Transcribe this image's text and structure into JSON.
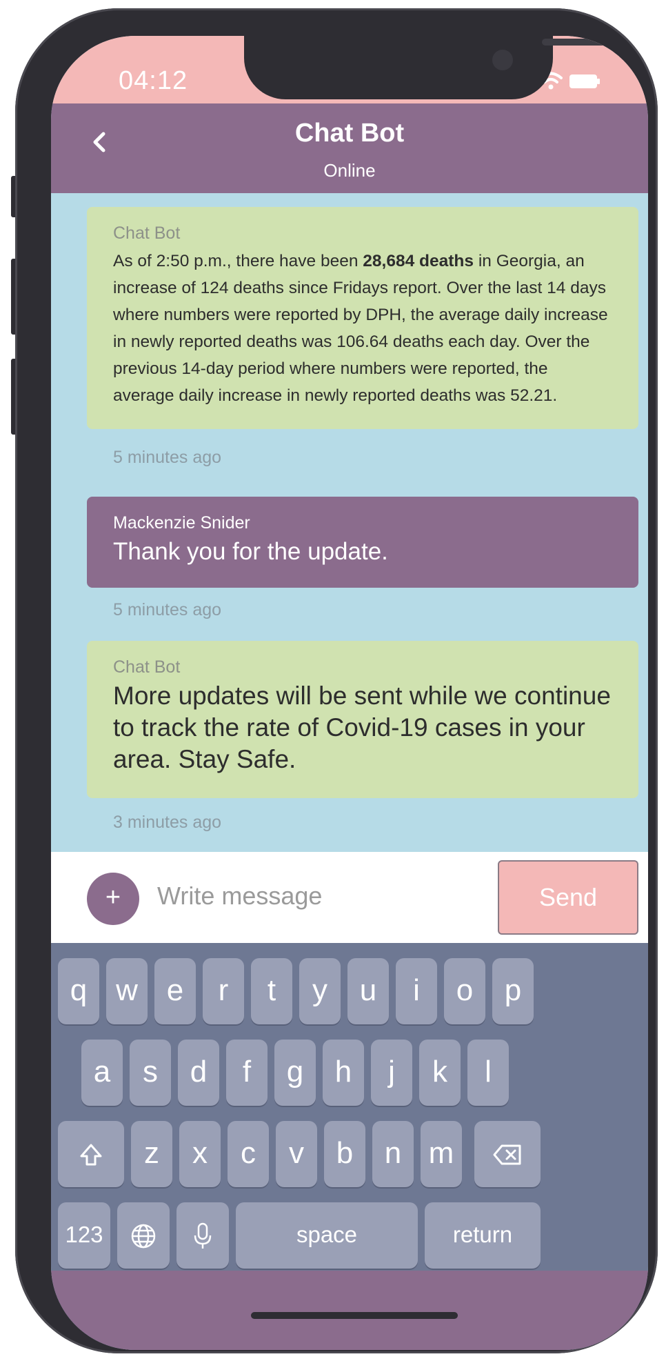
{
  "status_bar": {
    "time": "04:12"
  },
  "header": {
    "title": "Chat Bot",
    "status": "Online",
    "back_icon": "chevron-left-icon"
  },
  "messages": [
    {
      "sender": "Chat Bot",
      "text_before": "As of 2:50 p.m., there have been ",
      "text_bold": "28,684 deaths",
      "text_after": " in Georgia, an increase of 124 deaths since Fridays report. Over the last 14 days where numbers were reported by DPH, the average daily increase in newly reported deaths was 106.64 deaths each day. Over the previous 14-day period where numbers were reported, the average daily increase in newly reported deaths was 52.21.",
      "time": "5 minutes ago"
    },
    {
      "sender": "Mackenzie Snider",
      "text": "Thank you for the update.",
      "time": "5 minutes ago"
    },
    {
      "sender": "Chat Bot",
      "text": "More updates will be sent while we continue to track the rate of Covid-19 cases in your area. Stay Safe.",
      "time": "3 minutes ago"
    }
  ],
  "composer": {
    "plus_label": "+",
    "placeholder": "Write message",
    "send_label": "Send"
  },
  "keyboard": {
    "row1": [
      "q",
      "w",
      "e",
      "r",
      "t",
      "y",
      "u",
      "i",
      "o",
      "p"
    ],
    "row2": [
      "a",
      "s",
      "d",
      "f",
      "g",
      "h",
      "j",
      "k",
      "l"
    ],
    "row3": [
      "z",
      "x",
      "c",
      "v",
      "b",
      "n",
      "m"
    ],
    "numbers_label": "123",
    "space_label": "space",
    "return_label": "return"
  },
  "colors": {
    "header": "#8b6c8d",
    "status_bar": "#f4b8b7",
    "chat_background": "#b6dbe7",
    "bot_bubble": "#d0e2b0",
    "user_bubble": "#8b6c8d",
    "keyboard": "#6e7893",
    "key": "#9aa0b6"
  }
}
